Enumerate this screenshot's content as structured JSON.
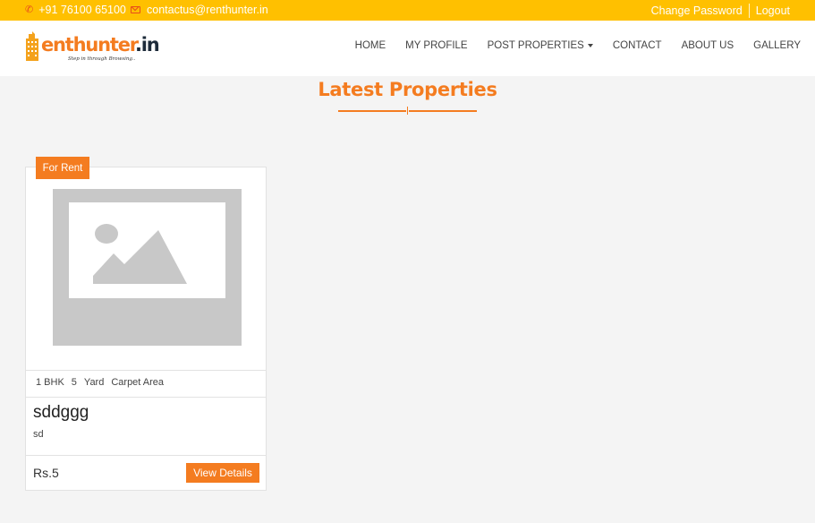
{
  "topbar": {
    "phone": "+91 76100 65100",
    "email": "contactus@renthunter.in",
    "change_password": "Change Password",
    "logout": "Logout"
  },
  "brand": {
    "name_main": "enthunter",
    "name_suffix": ".in",
    "tagline": "Step in through Browsing..",
    "accent_color": "#f47c20"
  },
  "nav": {
    "items": [
      "HOME",
      "MY PROFILE",
      "POST PROPERTIES",
      "CONTACT",
      "ABOUT US",
      "GALLERY"
    ]
  },
  "section": {
    "title": "Latest Properties"
  },
  "listing": {
    "badge": "For Rent",
    "bhk": "1 BHK",
    "area_value": "5",
    "area_unit": "Yard",
    "area_type": "Carpet Area",
    "title": "sddggg",
    "description": "sd",
    "price": "Rs.5",
    "cta": "View Details",
    "image_icon": "image-placeholder-icon"
  }
}
